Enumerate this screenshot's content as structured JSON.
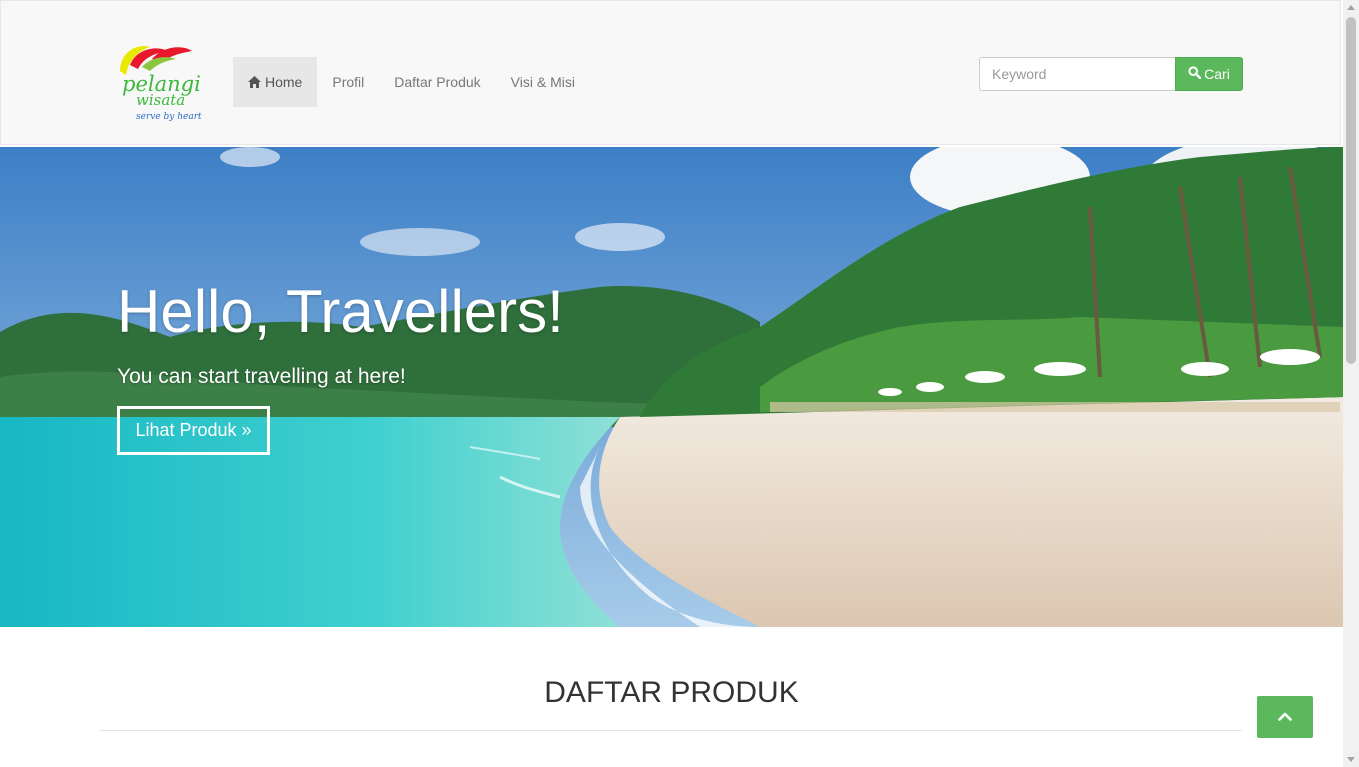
{
  "header": {
    "logo": {
      "line1": "pelangi",
      "line2": "wisata",
      "tagline": "serve by heart"
    },
    "nav": [
      {
        "label": "Home",
        "icon": "home-icon",
        "active": true
      },
      {
        "label": "Profil",
        "active": false
      },
      {
        "label": "Daftar Produk",
        "active": false
      },
      {
        "label": "Visi & Misi",
        "active": false
      }
    ],
    "search": {
      "placeholder": "Keyword",
      "value": "",
      "button_label": "Cari",
      "button_icon": "search-icon"
    }
  },
  "hero": {
    "title": "Hello, Travellers!",
    "subtitle": "You can start travelling at here!",
    "button_label": "Lihat Produk »"
  },
  "section": {
    "title": "DAFTAR PRODUK"
  },
  "back_to_top": {
    "icon": "chevron-up-icon"
  },
  "colors": {
    "accent": "#5cb85c",
    "navbar_bg": "#f8f8f8",
    "nav_active_bg": "#e7e7e7"
  }
}
